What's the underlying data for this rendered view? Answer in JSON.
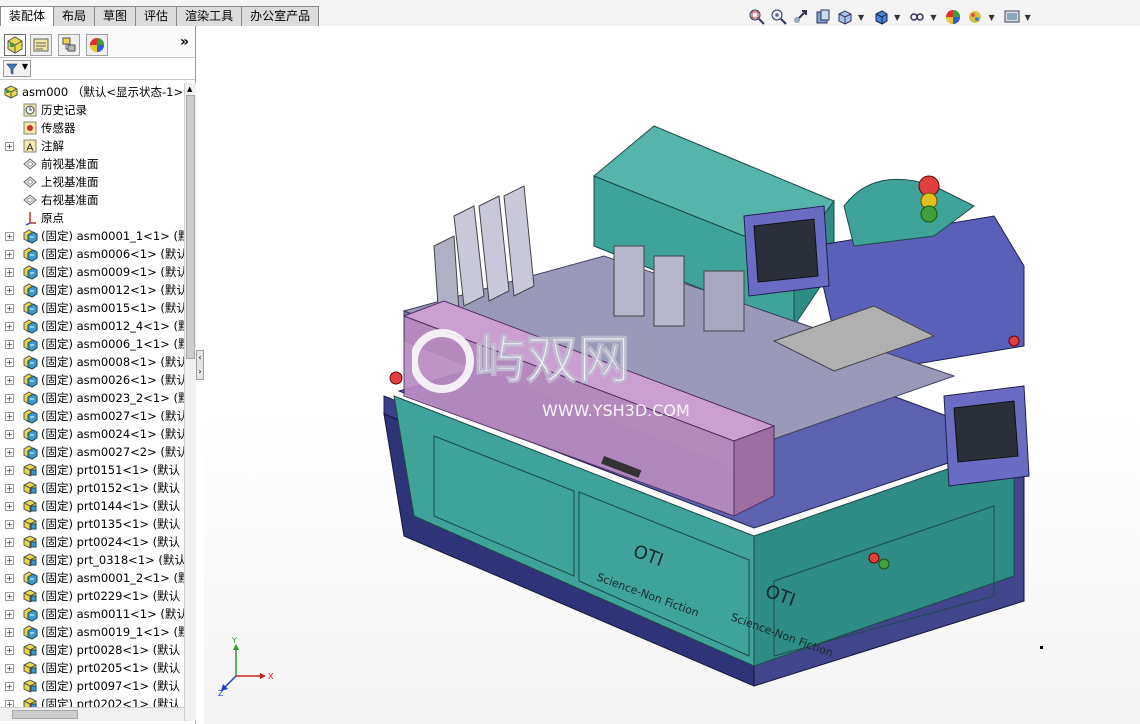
{
  "tabs": [
    {
      "label": "装配体",
      "active": true
    },
    {
      "label": "布局",
      "active": false
    },
    {
      "label": "草图",
      "active": false
    },
    {
      "label": "评估",
      "active": false
    },
    {
      "label": "渲染工具",
      "active": false
    },
    {
      "label": "办公室产品",
      "active": false
    }
  ],
  "panel": {
    "icons": [
      "feature-manager-icon",
      "property-manager-icon",
      "configuration-manager-icon",
      "display-manager-icon"
    ],
    "expand_label": "»"
  },
  "tree": {
    "root": "asm000 （默认<显示状态-1>",
    "items": [
      {
        "label": "历史记录",
        "icon": "history-icon",
        "expandable": false
      },
      {
        "label": "传感器",
        "icon": "sensor-icon",
        "expandable": false
      },
      {
        "label": "注解",
        "icon": "annotation-icon",
        "expandable": true
      },
      {
        "label": "前视基准面",
        "icon": "plane-icon",
        "expandable": false
      },
      {
        "label": "上视基准面",
        "icon": "plane-icon",
        "expandable": false
      },
      {
        "label": "右视基准面",
        "icon": "plane-icon",
        "expandable": false
      },
      {
        "label": "原点",
        "icon": "origin-icon",
        "expandable": false
      },
      {
        "label": "(固定) asm0001_1<1> (默",
        "icon": "assembly-icon",
        "expandable": true
      },
      {
        "label": "(固定) asm0006<1> (默认",
        "icon": "assembly-icon",
        "expandable": true
      },
      {
        "label": "(固定) asm0009<1> (默认",
        "icon": "assembly-icon",
        "expandable": true
      },
      {
        "label": "(固定) asm0012<1> (默认",
        "icon": "assembly-icon",
        "expandable": true
      },
      {
        "label": "(固定) asm0015<1> (默认",
        "icon": "assembly-icon",
        "expandable": true
      },
      {
        "label": "(固定) asm0012_4<1> (默",
        "icon": "assembly-icon",
        "expandable": true
      },
      {
        "label": "(固定) asm0006_1<1> (默",
        "icon": "assembly-icon",
        "expandable": true
      },
      {
        "label": "(固定) asm0008<1> (默认",
        "icon": "assembly-icon",
        "expandable": true
      },
      {
        "label": "(固定) asm0026<1> (默认",
        "icon": "assembly-icon",
        "expandable": true
      },
      {
        "label": "(固定) asm0023_2<1> (默",
        "icon": "assembly-icon",
        "expandable": true
      },
      {
        "label": "(固定) asm0027<1> (默认",
        "icon": "assembly-icon",
        "expandable": true
      },
      {
        "label": "(固定) asm0024<1> (默认",
        "icon": "assembly-icon",
        "expandable": true
      },
      {
        "label": "(固定) asm0027<2> (默认",
        "icon": "assembly-icon",
        "expandable": true
      },
      {
        "label": "(固定) prt0151<1> (默认",
        "icon": "part-icon",
        "expandable": true
      },
      {
        "label": "(固定) prt0152<1> (默认",
        "icon": "part-icon",
        "expandable": true
      },
      {
        "label": "(固定) prt0144<1> (默认",
        "icon": "part-icon",
        "expandable": true
      },
      {
        "label": "(固定) prt0135<1> (默认",
        "icon": "part-icon",
        "expandable": true
      },
      {
        "label": "(固定) prt0024<1> (默认",
        "icon": "part-icon",
        "expandable": true
      },
      {
        "label": "(固定) prt_0318<1> (默认",
        "icon": "part-icon",
        "expandable": true
      },
      {
        "label": "(固定) asm0001_2<1> (默",
        "icon": "assembly-icon",
        "expandable": true
      },
      {
        "label": "(固定) prt0229<1> (默认",
        "icon": "part-icon",
        "expandable": true
      },
      {
        "label": "(固定) asm0011<1> (默认",
        "icon": "assembly-icon",
        "expandable": true
      },
      {
        "label": "(固定) asm0019_1<1> (默",
        "icon": "assembly-icon",
        "expandable": true
      },
      {
        "label": "(固定) prt0028<1> (默认",
        "icon": "part-icon",
        "expandable": true
      },
      {
        "label": "(固定) prt0205<1> (默认",
        "icon": "part-icon",
        "expandable": true
      },
      {
        "label": "(固定) prt0097<1> (默认",
        "icon": "part-icon",
        "expandable": true
      },
      {
        "label": "(固定) prt0202<1> (默认",
        "icon": "part-icon",
        "expandable": true
      }
    ]
  },
  "viewport": {
    "model_texts": {
      "brand": "OTI",
      "slogan": "Science-Non Fiction"
    },
    "watermark": {
      "logo": "屿双网",
      "url": "WWW.YSH3D.COM"
    },
    "triad": {
      "x": "X",
      "y": "Y",
      "z": "Z"
    }
  },
  "colors": {
    "cabinet": "#3fa39a",
    "base": "#5a5fae",
    "chassis": "#8a87b8",
    "pink_cover": "#b98cc0",
    "hmi_frame": "#6a6cc4"
  }
}
